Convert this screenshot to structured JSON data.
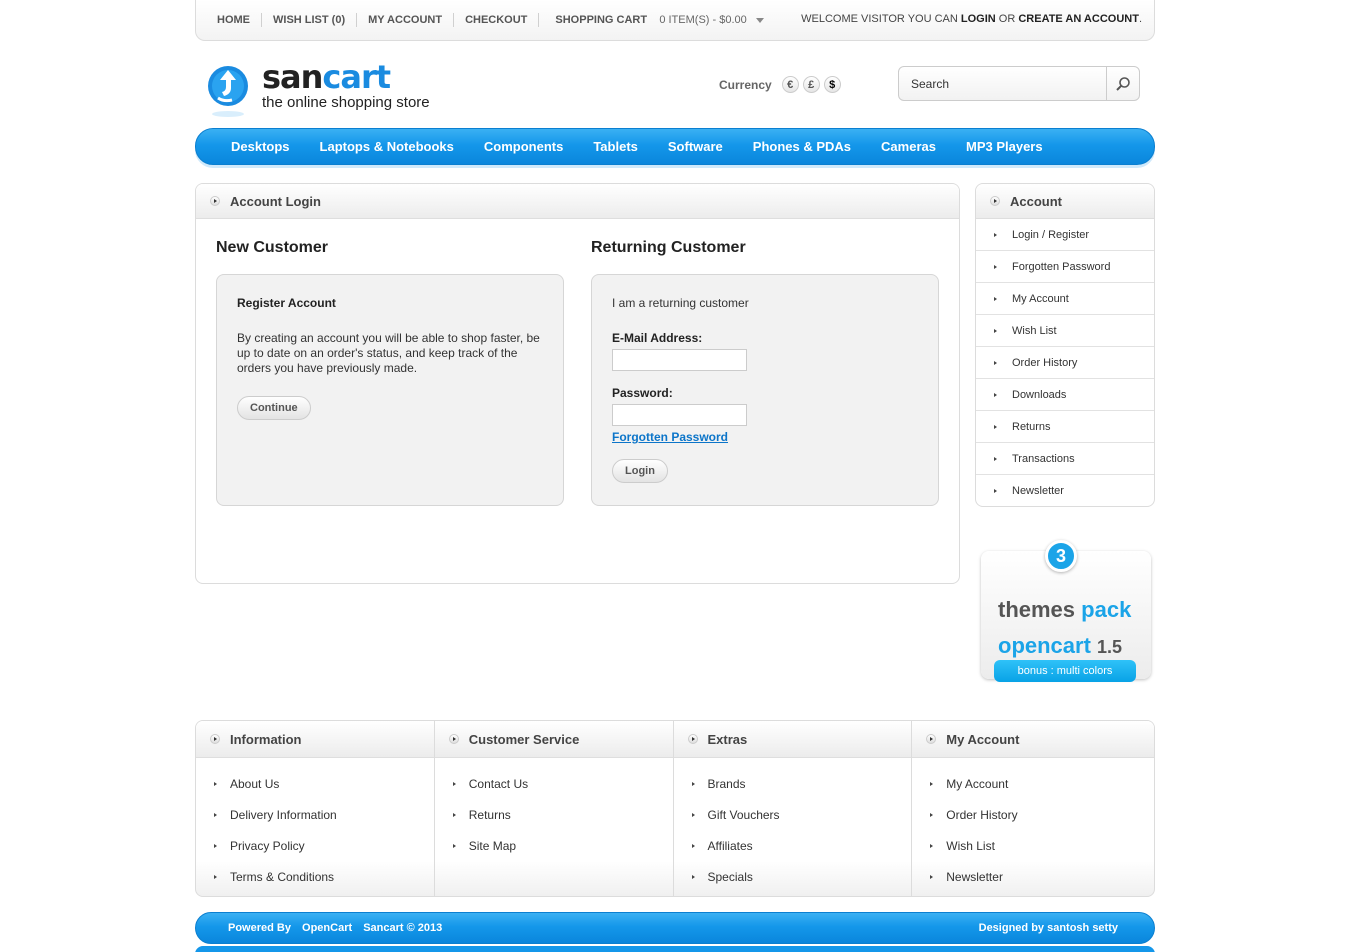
{
  "topbar": {
    "links": [
      "HOME",
      "WISH LIST (0)",
      "MY ACCOUNT",
      "CHECKOUT"
    ],
    "cart_label": "SHOPPING CART",
    "cart_summary": "0 ITEM(S) - $0.00",
    "welcome_prefix": "WELCOME VISITOR YOU CAN ",
    "login_label": "LOGIN",
    "welcome_or": " OR ",
    "create_label": "CREATE AN ACCOUNT",
    "welcome_suffix": "."
  },
  "header": {
    "logo_part1": "san",
    "logo_part2": "cart",
    "logo_tagline": "the online shopping store",
    "currency_label": "Currency",
    "currencies": [
      "€",
      "£",
      "$"
    ],
    "search_placeholder": "Search"
  },
  "nav": {
    "items": [
      "Desktops",
      "Laptops & Notebooks",
      "Components",
      "Tablets",
      "Software",
      "Phones & PDAs",
      "Cameras",
      "MP3 Players"
    ]
  },
  "content": {
    "heading": "Account Login",
    "new_customer": {
      "title": "New Customer",
      "panel_title": "Register Account",
      "text": "By creating an account you will be able to shop faster, be up to date on an order's status, and keep track of the orders you have previously made.",
      "button": "Continue"
    },
    "returning_customer": {
      "title": "Returning Customer",
      "intro": "I am a returning customer",
      "email_label": "E-Mail Address:",
      "email_value": "",
      "password_label": "Password:",
      "password_value": "",
      "forgot_link": "Forgotten Password",
      "button": "Login"
    }
  },
  "sidebar": {
    "heading": "Account",
    "items": [
      "Login / Register",
      "Forgotten Password",
      "My Account",
      "Wish List",
      "Order History",
      "Downloads",
      "Returns",
      "Transactions",
      "Newsletter"
    ]
  },
  "banner": {
    "badge": "3",
    "line1_a": "themes ",
    "line1_b": "pack",
    "line2_a": "opencart ",
    "line2_b": "1.5",
    "bonus": "bonus : multi colors"
  },
  "footer": {
    "columns": [
      {
        "heading": "Information",
        "items": [
          "About Us",
          "Delivery Information",
          "Privacy Policy",
          "Terms & Conditions"
        ]
      },
      {
        "heading": "Customer Service",
        "items": [
          "Contact Us",
          "Returns",
          "Site Map"
        ]
      },
      {
        "heading": "Extras",
        "items": [
          "Brands",
          "Gift Vouchers",
          "Affiliates",
          "Specials"
        ]
      },
      {
        "heading": "My Account",
        "items": [
          "My Account",
          "Order History",
          "Wish List",
          "Newsletter"
        ]
      }
    ],
    "powered_by": "Powered By",
    "powered_opencart": "OpenCart",
    "copyright": "Sancart © 2013",
    "designed_by": "Designed by santosh setty"
  },
  "colors": {
    "accent": "#1497ea",
    "link": "#0c75c9"
  }
}
